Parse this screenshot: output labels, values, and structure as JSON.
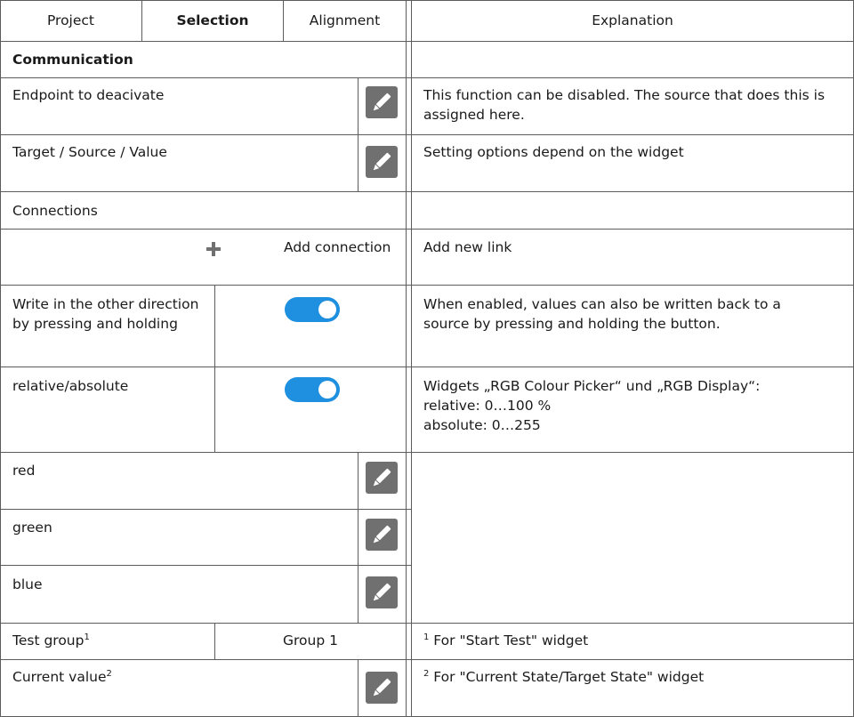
{
  "header": {
    "tab_project": "Project",
    "tab_selection": "Selection",
    "tab_alignment": "Alignment",
    "explanation": "Explanation"
  },
  "rows": {
    "communication": "Communication",
    "endpoint": {
      "label": "Endpoint to deacivate",
      "explanation": "This function can be disabled. The source that does this is assigned here."
    },
    "target": {
      "label": "Target / Source / Value",
      "explanation": "Setting options depend on the widget"
    },
    "connections": "Connections",
    "add_connection": {
      "label": "Add connection",
      "explanation": "Add new link"
    },
    "write_other": {
      "label": "Write in the other direction by pressing and holding",
      "explanation": "When enabled, values can also be written back to a source by pressing and holding the button.",
      "enabled": true
    },
    "relabs": {
      "label": "relative/absolute",
      "explanation_line1": "Widgets „RGB Colour Picker“ und „RGB Display“:",
      "explanation_line2": "relative: 0…100 %",
      "explanation_line3": "absolute: 0…255",
      "enabled": true
    },
    "red": "red",
    "green": "green",
    "blue": "blue",
    "test_group": {
      "label": "Test group",
      "sup": "1",
      "value": "Group 1",
      "explanation_sup": "1",
      "explanation": " For \"Start Test\" widget"
    },
    "current_value": {
      "label": "Current value",
      "sup": "2",
      "explanation_sup": "2",
      "explanation": " For \"Current State/Target State\" widget"
    }
  },
  "colors": {
    "toggle": "#1f8fe0",
    "edit_button": "#707070",
    "border": "#5c5c5c"
  }
}
